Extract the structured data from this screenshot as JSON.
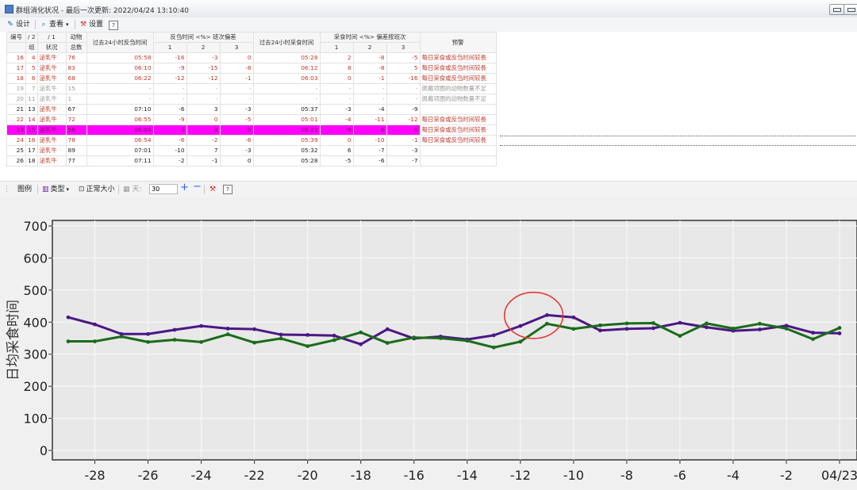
{
  "window": {
    "title": "群组消化状况 - 最后一次更新: 2022/04/24 13:10:40"
  },
  "toolbar": {
    "design": "设计",
    "view": "查看",
    "settings": "设置"
  },
  "table": {
    "headers": {
      "id": "编号",
      "group_num": "/ 2",
      "group": "组",
      "status_num": "/ 1",
      "status": "状况",
      "count_a": "动物",
      "count_b": "总数",
      "rum_time": "过去24小时反刍时间",
      "rum_dev": "反刍时间 <%> 班次偏差",
      "eat_time": "过去24小时采食时间",
      "eat_dev": "采食时间 <%> 偏差按班次",
      "warning": "预警",
      "d1": "1",
      "d2": "2",
      "d3": "3"
    },
    "rows": [
      {
        "id": "16",
        "grp": "4",
        "status": "泌乳牛",
        "count": "76",
        "rum": "05:58",
        "r1": "-16",
        "r2": "-3",
        "r3": "0",
        "eat": "05:28",
        "e1": "2",
        "e2": "-8",
        "e3": "-5",
        "warn": "每日采食或反刍时间较長"
      },
      {
        "id": "17",
        "grp": "5",
        "status": "泌乳牛",
        "count": "83",
        "rum": "06:10",
        "r1": "-9",
        "r2": "-15",
        "r3": "-8",
        "eat": "06:12",
        "e1": "8",
        "e2": "-8",
        "e3": "5",
        "warn": "每日采食或反刍时间较長"
      },
      {
        "id": "18",
        "grp": "6",
        "status": "泌乳牛",
        "count": "68",
        "rum": "06:22",
        "r1": "-12",
        "r2": "-12",
        "r3": "-1",
        "eat": "06:03",
        "e1": "0",
        "e2": "-1",
        "e3": "-16",
        "warn": "每日采食或反刍时间较長"
      },
      {
        "id": "19",
        "grp": "7",
        "status": "泌乳牛",
        "count": "15",
        "rum": "-",
        "r1": "-",
        "r2": "-",
        "r3": "-",
        "eat": "-",
        "e1": "-",
        "e2": "-",
        "e3": "-",
        "warn": "佩戴项圈的动物数量不足"
      },
      {
        "id": "20",
        "grp": "11",
        "status": "泌乳牛",
        "count": "1",
        "rum": "-",
        "r1": "-",
        "r2": "-",
        "r3": "-",
        "eat": "-",
        "e1": "-",
        "e2": "-",
        "e3": "-",
        "warn": "佩戴项圈的动物数量不足"
      },
      {
        "id": "21",
        "grp": "13",
        "status": "泌乳牛",
        "count": "67",
        "rum": "07:10",
        "r1": "-6",
        "r2": "3",
        "r3": "-3",
        "eat": "05:37",
        "e1": "-3",
        "e2": "-4",
        "e3": "-9",
        "warn": ""
      },
      {
        "id": "22",
        "grp": "14",
        "status": "泌乳牛",
        "count": "72",
        "rum": "06:55",
        "r1": "-9",
        "r2": "0",
        "r3": "-5",
        "eat": "05:01",
        "e1": "-4",
        "e2": "-11",
        "e3": "-12",
        "warn": "每日采食或反刍时间较長"
      },
      {
        "id": "23",
        "grp": "15",
        "status": "泌乳牛",
        "count": "56",
        "rum": "06:04",
        "r1": "0",
        "r2": "0",
        "r3": "-5",
        "eat": "06:21",
        "e1": "-9",
        "e2": "6",
        "e3": "0",
        "warn": "每日采食或反刍时间较長"
      },
      {
        "id": "24",
        "grp": "16",
        "status": "泌乳牛",
        "count": "78",
        "rum": "06:54",
        "r1": "-6",
        "r2": "-2",
        "r3": "-6",
        "eat": "05:39",
        "e1": "0",
        "e2": "-10",
        "e3": "-1",
        "warn": "每日采食或反刍时间较長"
      },
      {
        "id": "25",
        "grp": "17",
        "status": "泌乳牛",
        "count": "89",
        "rum": "07:01",
        "r1": "-10",
        "r2": "7",
        "r3": "-3",
        "eat": "05:32",
        "e1": "6",
        "e2": "-7",
        "e3": "-3",
        "warn": ""
      },
      {
        "id": "26",
        "grp": "18",
        "status": "泌乳牛",
        "count": "77",
        "rum": "07:11",
        "r1": "-2",
        "r2": "-1",
        "r3": "0",
        "eat": "05:28",
        "e1": "-5",
        "e2": "-6",
        "e3": "-7",
        "warn": ""
      }
    ]
  },
  "chart_toolbar": {
    "legend": "图例",
    "type": "类型",
    "normal_size": "正常大小",
    "days_label": "天:",
    "days_value": "30"
  },
  "chart_data": {
    "type": "line",
    "ylabel": "日均采食时间",
    "ylim": [
      0,
      700
    ],
    "yticks": [
      "0",
      "100",
      "200",
      "300",
      "400",
      "500",
      "600",
      "700"
    ],
    "xlim": [
      -29.5,
      0.5
    ],
    "xticks": [
      {
        "x": -28,
        "label": "-28"
      },
      {
        "x": -26,
        "label": "-26"
      },
      {
        "x": -24,
        "label": "-24"
      },
      {
        "x": -22,
        "label": "-22"
      },
      {
        "x": -20,
        "label": "-20"
      },
      {
        "x": -18,
        "label": "-18"
      },
      {
        "x": -16,
        "label": "-16"
      },
      {
        "x": -14,
        "label": "-14"
      },
      {
        "x": -12,
        "label": "-12"
      },
      {
        "x": -10,
        "label": "-10"
      },
      {
        "x": -8,
        "label": "-8"
      },
      {
        "x": -6,
        "label": "-6"
      },
      {
        "x": -4,
        "label": "-4"
      },
      {
        "x": -2,
        "label": "-2"
      },
      {
        "x": 0,
        "label": "04/23"
      }
    ],
    "x": [
      -29,
      -28,
      -27,
      -26,
      -25,
      -24,
      -23,
      -22,
      -21,
      -20,
      -19,
      -18,
      -17,
      -16,
      -15,
      -14,
      -13,
      -12,
      -11,
      -10,
      -9,
      -8,
      -7,
      -6,
      -5,
      -4,
      -3,
      -2,
      -1,
      0
    ],
    "grid": true,
    "series": [
      {
        "color": "#4b1784",
        "values": [
          415,
          393,
          363,
          363,
          376,
          388,
          380,
          378,
          361,
          360,
          358,
          331,
          378,
          349,
          355,
          346,
          359,
          388,
          422,
          415,
          374,
          379,
          381,
          398,
          384,
          373,
          377,
          389,
          367,
          365
        ]
      },
      {
        "color": "#1a6b1a",
        "values": [
          340,
          340,
          355,
          338,
          345,
          338,
          362,
          336,
          349,
          325,
          344,
          368,
          335,
          352,
          350,
          342,
          321,
          339,
          395,
          379,
          390,
          396,
          397,
          357,
          396,
          380,
          395,
          380,
          347,
          382
        ]
      }
    ],
    "annotation": {
      "type": "ellipse",
      "color": "#e53935",
      "cx": -11.5,
      "cy": 421,
      "rx": 1.1,
      "ry": 144
    }
  }
}
